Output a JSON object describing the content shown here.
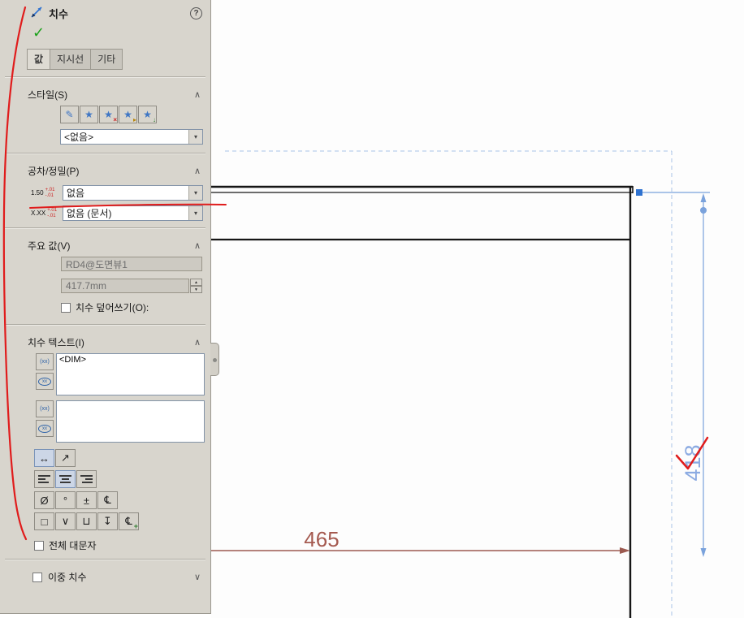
{
  "colors": {
    "panel_bg": "#d8d5cd",
    "ok_green": "#1aa11a",
    "dimension_blue": "#8cabe2",
    "handle_blue": "#2f72d0",
    "dimension_maroon": "#a55a50",
    "annotation_red": "#e01c1c"
  },
  "icons": {
    "help": "?",
    "ok": "✓",
    "collapse": "∧",
    "expand": "∨",
    "dropdown_arrow": "▾",
    "spin_up": "▲",
    "spin_down": "▼",
    "fav_apply": "✎",
    "fav_star": "★",
    "fav_delete_badge": "×",
    "fav_load_badge": "▸",
    "fav_save_badge": "↓",
    "paren_text": "(xx)",
    "inspection_text": "xx",
    "center_dim_text": "↔",
    "slant_dim_text": "↗"
  },
  "panel": {
    "title": "치수",
    "tabs": {
      "value": "값",
      "leader": "지시선",
      "other": "기타"
    },
    "style": {
      "title": "스타일(S)",
      "dropdown_value": "<없음>"
    },
    "tolerance": {
      "title": "공차/정밀(P)",
      "tol_icon": {
        "main": "1.50",
        "plus": "+.01",
        "minus": "-.01"
      },
      "prec_icon": {
        "main": "X.XX",
        "plus": "+.01",
        "minus": "-.01"
      },
      "tolerance_value": "없음",
      "precision_value": "없음 (문서)"
    },
    "primary": {
      "title": "주요 값(V)",
      "name_value": "RD4@도면뷰1",
      "dim_value": "417.7mm",
      "override_label": "치수 덮어쓰기(O):"
    },
    "dim_text": {
      "title": "치수 텍스트(I)",
      "main_text": "<DIM>",
      "secondary_text": "",
      "symbols": {
        "diameter": "Ø",
        "degree": "°",
        "plus_minus": "±",
        "centerline": "℄",
        "square": "□",
        "countersink": "∨",
        "counterbore": "⊔",
        "depth": "↧",
        "more": "℄",
        "more_badge": "+"
      }
    },
    "all_caps_label": "전체 대문자",
    "dual_label": "이중 치수"
  },
  "drawing": {
    "vertical_dim": "418",
    "horizontal_dim": "465"
  }
}
